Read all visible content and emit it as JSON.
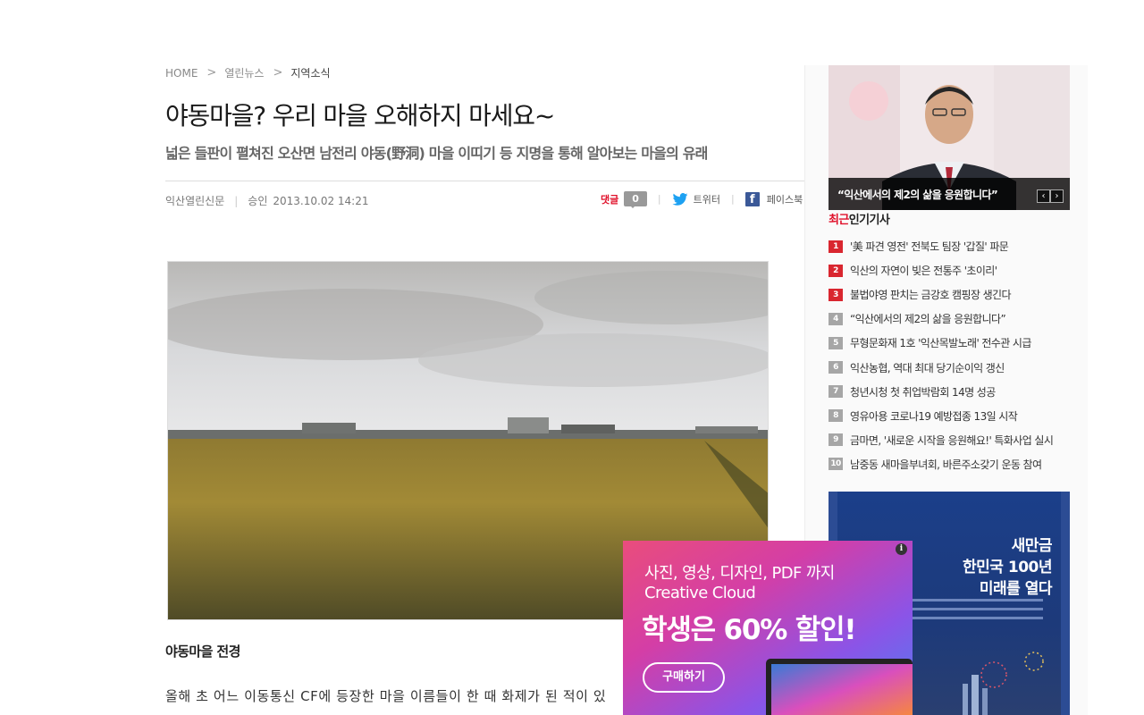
{
  "breadcrumb": {
    "home": "HOME",
    "section": "열린뉴스",
    "current": "지역소식"
  },
  "article": {
    "title": "야동마을? 우리 마을 오해하지 마세요~",
    "subtitle": "넓은 들판이 펼쳐진 오산면 남전리 야동(野洞) 마을 이띠기 등 지명을 통해 알아보는 마을의 유래",
    "publisher": "익산열린신문",
    "approved_label": "승인",
    "date": "2013.10.02 14:21",
    "caption": "야동마을 전경",
    "body_first_line": "올해 초 어느 이동통신 CF에 등장한 마을 이름들이 한 때 화제가 된 적이 있"
  },
  "share": {
    "reply_label": "댓글",
    "reply_count": "0",
    "twitter_label": "트위터",
    "facebook_label": "페이스북"
  },
  "sidebar": {
    "feature_caption": "“익산에서의 제2의 삶을 응원합니다”",
    "feature_prev": "‹",
    "feature_next": "›",
    "popular_head_accent": "최근",
    "popular_head_rest": "인기기사",
    "popular": [
      {
        "rank": "1",
        "title": "'美 파견 영전' 전북도 팀장 '갑질' 파문"
      },
      {
        "rank": "2",
        "title": "익산의 자연이 빚은 전통주 '초이리'"
      },
      {
        "rank": "3",
        "title": "불법야영 판치는 금강호 캠핑장 생긴다"
      },
      {
        "rank": "4",
        "title": "“익산에서의 제2의 삶을 응원합니다”"
      },
      {
        "rank": "5",
        "title": "무형문화재 1호 '익산목발노래' 전수관 시급"
      },
      {
        "rank": "6",
        "title": "익산농협, 역대 최대 당기순이익 갱신"
      },
      {
        "rank": "7",
        "title": "청년시청 첫 취업박람회 14명 성공"
      },
      {
        "rank": "8",
        "title": "영유아용 코로나19 예방접종 13일 시작"
      },
      {
        "rank": "9",
        "title": "금마면, '새로운 시작을 응원해요!' 특화사업 실시"
      },
      {
        "rank": "10",
        "title": "남중동 새마을부녀회, 바른주소갖기 운동 참여"
      }
    ],
    "banner_lines": [
      "새만금",
      "한민국 100년",
      "미래를 열다"
    ]
  },
  "popup_ad": {
    "line1": "사진, 영상, 디자인, PDF 까지",
    "line2": "Creative Cloud",
    "line3": "학생은 60% 할인!",
    "button": "구매하기",
    "info": "i"
  },
  "colors": {
    "accent_red": "#e0102a",
    "rank_hot": "#d9262f",
    "rank_normal": "#a6a6a6",
    "facebook": "#3b5998",
    "twitter": "#1da1f2"
  }
}
